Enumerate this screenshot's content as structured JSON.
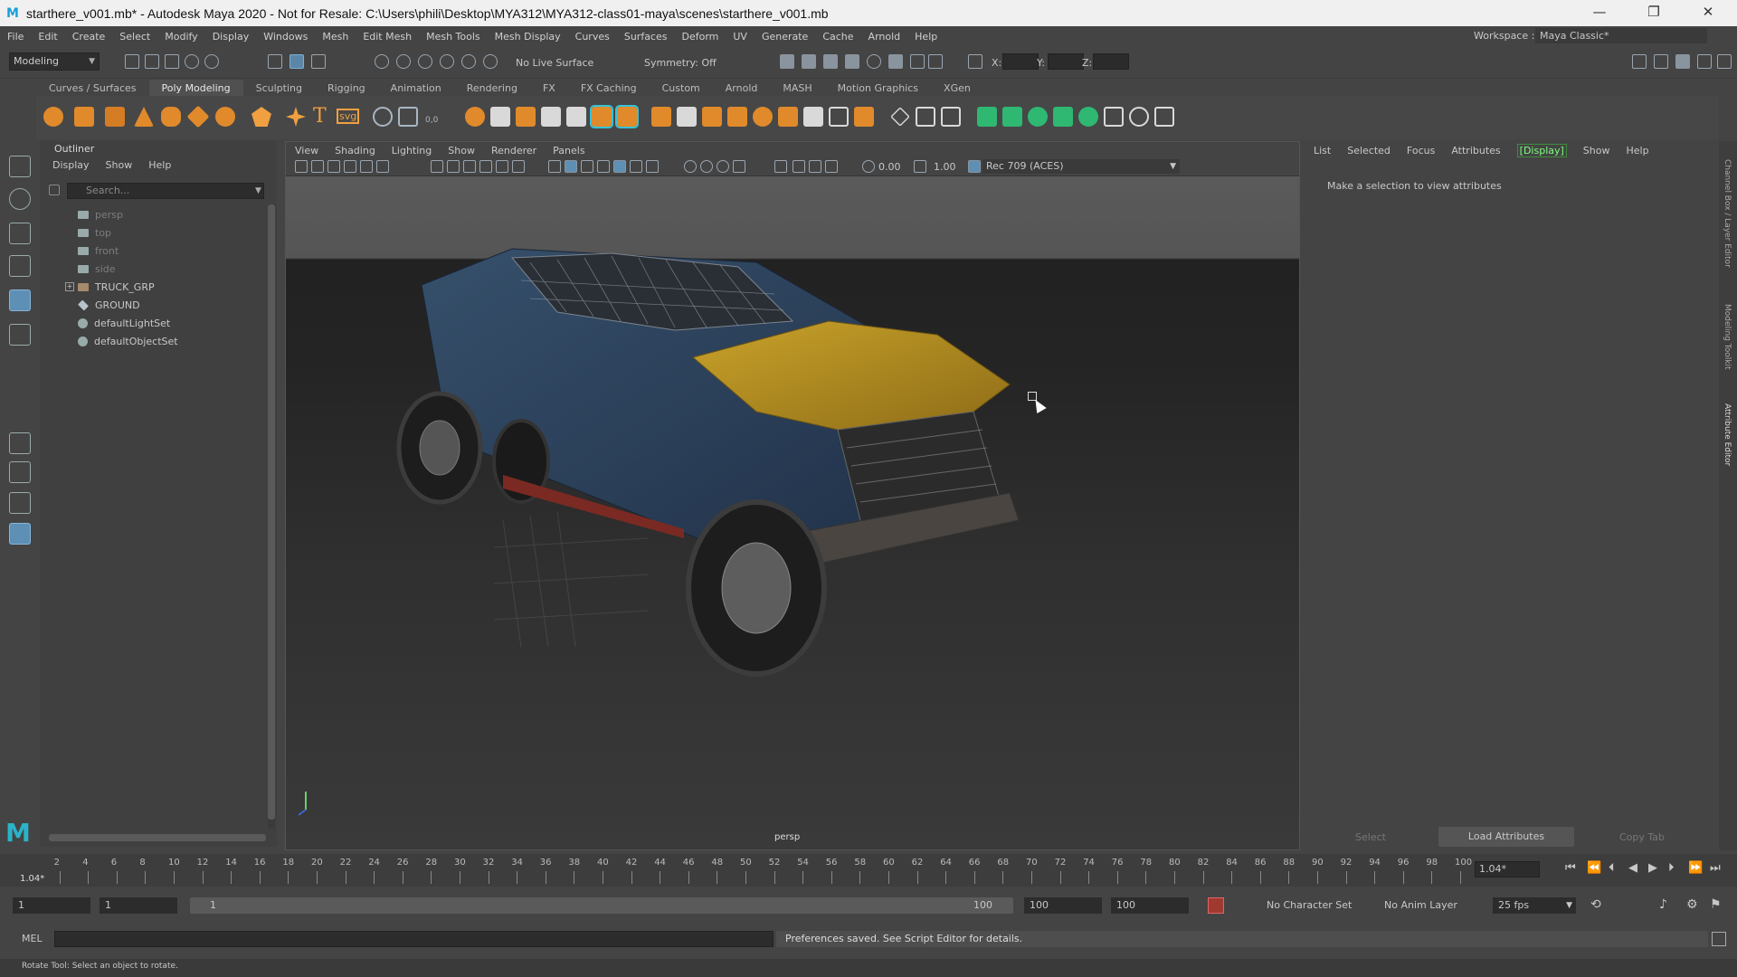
{
  "window": {
    "title": "starthere_v001.mb* - Autodesk Maya 2020 - Not for Resale: C:\\Users\\phili\\Desktop\\MYA312\\MYA312-class01-maya\\scenes\\starthere_v001.mb",
    "controls": [
      "—",
      "❐",
      "✕"
    ]
  },
  "menubar": {
    "items": [
      "File",
      "Edit",
      "Create",
      "Select",
      "Modify",
      "Display",
      "Windows",
      "Mesh",
      "Edit Mesh",
      "Mesh Tools",
      "Mesh Display",
      "Curves",
      "Surfaces",
      "Deform",
      "UV",
      "Generate",
      "Cache",
      "Arnold",
      "Help"
    ],
    "workspace_label": "Workspace :",
    "workspace_value": "Maya Classic*"
  },
  "statusline": {
    "menuset": "Modeling",
    "live_surface": "No Live Surface",
    "symmetry": "Symmetry: Off",
    "x_label": "X:",
    "y_label": "Y:",
    "z_label": "Z:"
  },
  "shelf": {
    "tabs": [
      "Curves / Surfaces",
      "Poly Modeling",
      "Sculpting",
      "Rigging",
      "Animation",
      "Rendering",
      "FX",
      "FX Caching",
      "Custom",
      "Arnold",
      "MASH",
      "Motion Graphics",
      "XGen"
    ],
    "active_tab": "Poly Modeling",
    "text_tool": "T",
    "svg_tool": "svg",
    "coord_tool": "0,0"
  },
  "outliner": {
    "title": "Outliner",
    "menu": [
      "Display",
      "Show",
      "Help"
    ],
    "search_placeholder": "Search...",
    "items": [
      {
        "label": "persp",
        "dim": true
      },
      {
        "label": "top",
        "dim": true
      },
      {
        "label": "front",
        "dim": true
      },
      {
        "label": "side",
        "dim": true
      },
      {
        "label": "TRUCK_GRP",
        "dim": false
      },
      {
        "label": "GROUND",
        "dim": false
      },
      {
        "label": "defaultLightSet",
        "dim": false
      },
      {
        "label": "defaultObjectSet",
        "dim": false
      }
    ]
  },
  "viewport": {
    "menu": [
      "View",
      "Shading",
      "Lighting",
      "Show",
      "Renderer",
      "Panels"
    ],
    "exposure": "0.00",
    "gamma": "1.00",
    "colorspace": "Rec 709 (ACES)",
    "camera_label": "persp"
  },
  "attribute_editor": {
    "menu": [
      "List",
      "Selected",
      "Focus",
      "Attributes",
      "[Display]",
      "Show",
      "Help"
    ],
    "message": "Make a selection to view attributes",
    "buttons": [
      "Select",
      "Load Attributes",
      "Copy Tab"
    ]
  },
  "side_tabs": [
    "Channel Box / Layer Editor",
    "Modeling Toolkit",
    "Attribute Editor"
  ],
  "timeline": {
    "ticks": [
      "2",
      "4",
      "6",
      "8",
      "10",
      "12",
      "14",
      "16",
      "18",
      "20",
      "22",
      "24",
      "26",
      "28",
      "30",
      "32",
      "34",
      "36",
      "38",
      "40",
      "42",
      "44",
      "46",
      "48",
      "50",
      "52",
      "54",
      "56",
      "58",
      "60",
      "62",
      "64",
      "66",
      "68",
      "70",
      "72",
      "74",
      "76",
      "78",
      "80",
      "82",
      "84",
      "86",
      "88",
      "90",
      "92",
      "94",
      "96",
      "98",
      "100"
    ],
    "current_frame_left": "1.04*",
    "current_frame": "1.04*"
  },
  "range": {
    "start": "1",
    "playback_start": "1",
    "slider_start": "1",
    "slider_end": "100",
    "playback_end": "100",
    "end": "100",
    "character_set": "No Character Set",
    "anim_layer": "No Anim Layer",
    "fps": "25 fps"
  },
  "cmdline": {
    "lang": "MEL",
    "result": "Preferences saved. See Script Editor for details."
  },
  "helpline": "Rotate Tool: Select an object to rotate.",
  "logo": "M",
  "colors": {
    "ui_bg": "#444444",
    "viewport_bg": "#2b2b2b",
    "accent_blue": "#5285a6",
    "active_green": "#7cff7c"
  }
}
